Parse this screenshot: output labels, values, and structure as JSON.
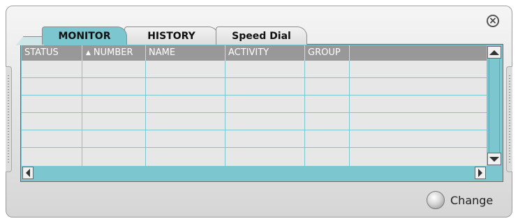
{
  "tabs": [
    {
      "label": "MONITOR",
      "active": true
    },
    {
      "label": "HISTORY",
      "active": false
    },
    {
      "label": "Speed Dial",
      "active": false
    }
  ],
  "table": {
    "columns": [
      {
        "label": "STATUS",
        "sorted": false
      },
      {
        "label": "NUMBER",
        "sorted": true,
        "sort_direction": "ascending"
      },
      {
        "label": "NAME",
        "sorted": false
      },
      {
        "label": "ACTIVITY",
        "sorted": false
      },
      {
        "label": "GROUP",
        "sorted": false
      },
      {
        "label": "",
        "sorted": false
      }
    ],
    "rows": [
      [
        "",
        "",
        "",
        "",
        "",
        ""
      ],
      [
        "",
        "",
        "",
        "",
        "",
        ""
      ],
      [
        "",
        "",
        "",
        "",
        "",
        ""
      ],
      [
        "",
        "",
        "",
        "",
        "",
        ""
      ],
      [
        "",
        "",
        "",
        "",
        "",
        ""
      ],
      [
        "",
        "",
        "",
        "",
        "",
        ""
      ]
    ]
  },
  "footer": {
    "change_label": "Change"
  },
  "icons": {
    "close": "close-icon",
    "sort": "sort-ascending-icon",
    "change": "change-orb-icon"
  },
  "colors": {
    "accent_teal": "#7cc6cf",
    "header_gray": "#989898",
    "grid_bg": "#e7e7e7"
  }
}
